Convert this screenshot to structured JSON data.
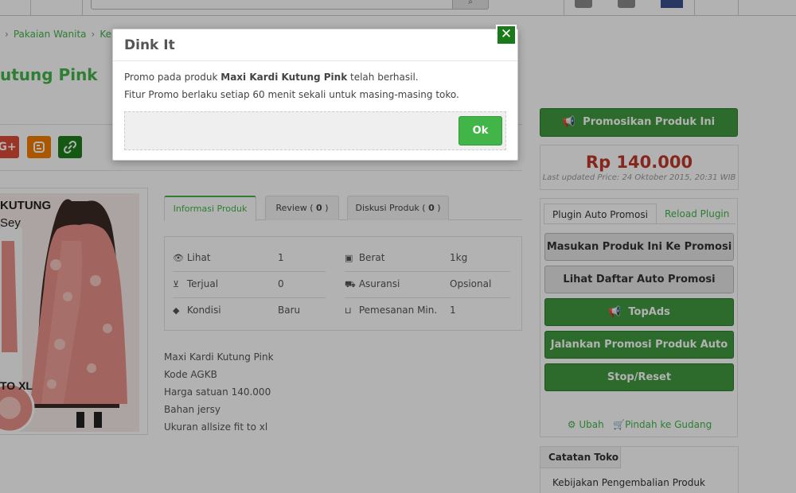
{
  "breadcrumb": {
    "item1": "Pakaian Wanita",
    "item2": "Keb"
  },
  "product": {
    "title": "utung Pink"
  },
  "share": {
    "google_label": "G+"
  },
  "image": {
    "title_text": "KUTUNG",
    "sub_text": "Sey",
    "size_text": "TO XL"
  },
  "tabs": [
    {
      "label": "Informasi Produk"
    },
    {
      "label": "Review ( 0 )",
      "text": "Review (",
      "count": "0",
      "suffix": " )"
    },
    {
      "label": "Diskusi Produk ( 0 )",
      "text": "Diskusi Produk (",
      "count": "0",
      "suffix": " )"
    }
  ],
  "info": {
    "lihat_label": "Lihat",
    "lihat_value": "1",
    "berat_label": "Berat",
    "berat_value": "1kg",
    "terjual_label": "Terjual",
    "terjual_value": "0",
    "asuransi_label": "Asuransi",
    "asuransi_value": "Opsional",
    "kondisi_label": "Kondisi",
    "kondisi_value": "Baru",
    "pemesanan_label": "Pemesanan Min.",
    "pemesanan_value": "1"
  },
  "description": [
    "Maxi Kardi Kutung Pink",
    "Kode AGKB",
    "Harga satuan 140.000",
    "Bahan jersy",
    "Ukuran allsize fit to xl"
  ],
  "sidebar": {
    "promote_button": "Promosikan Produk Ini",
    "price": "Rp 140.000",
    "last_updated": "Last updated Price: 24 Oktober 2015, 20:31 WIB",
    "plugin_tab": "Plugin Auto Promosi",
    "reload_link": "Reload Plugin",
    "buttons": [
      "Masukan Produk Ini Ke Promosi",
      "Lihat Daftar Auto Promosi",
      "TopAds",
      "Jalankan Promosi Produk Auto",
      "Stop/Reset"
    ],
    "ubah_link": "Ubah",
    "gudang_link": "Pindah ke Gudang",
    "store_notes_tab": "Catatan Toko",
    "store_notes_item": "Kebijakan Pengembalian Produk"
  },
  "modal": {
    "title": "Dink It",
    "msg1_prefix": "Promo pada produk ",
    "msg1_product": "Maxi Kardi Kutung Pink",
    "msg1_suffix": " telah berhasil.",
    "msg2": "Fitur Promo berlaku setiap 60 menit sekali untuk masing-masing toko.",
    "ok_label": "Ok",
    "close_glyph": "✕"
  },
  "colors": {
    "brand_green": "#42b549",
    "button_green": "#3f9a3f",
    "price_red": "#c0392b",
    "close_green": "#1a7a1a"
  },
  "icons": {
    "lihat": "eye-icon",
    "berat": "briefcase-icon",
    "terjual": "basket-icon",
    "asuransi": "truck-icon",
    "kondisi": "tag-icon",
    "pemesanan": "cart-icon",
    "promote": "megaphone-icon",
    "topads": "megaphone-icon",
    "ubah": "gear-icon",
    "gudang": "cart-arrow-icon"
  }
}
